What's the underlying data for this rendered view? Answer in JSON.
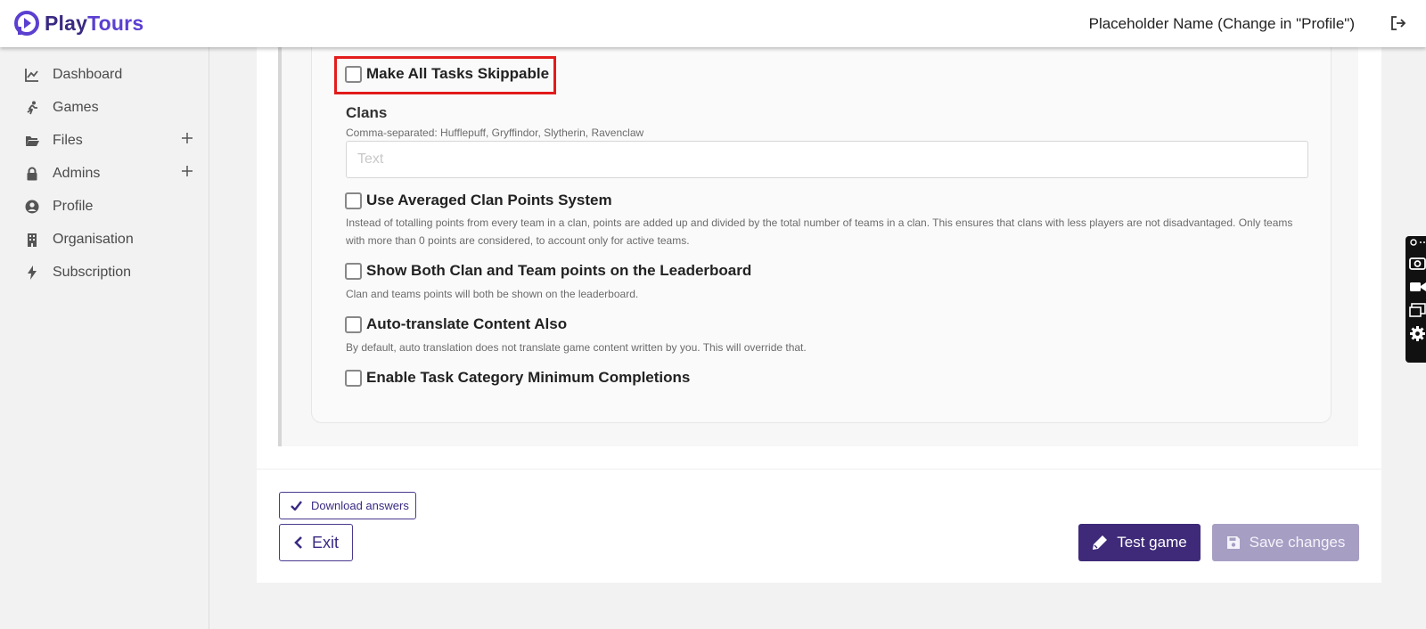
{
  "header": {
    "brand_play": "Play",
    "brand_tours": "Tours",
    "user_name": "Placeholder Name (Change in \"Profile\")"
  },
  "sidebar": {
    "items": [
      {
        "label": "Dashboard",
        "icon": "chart-line-icon"
      },
      {
        "label": "Games",
        "icon": "running-icon"
      },
      {
        "label": "Files",
        "icon": "folder-open-icon",
        "expandable": true
      },
      {
        "label": "Admins",
        "icon": "lock-icon",
        "expandable": true
      },
      {
        "label": "Profile",
        "icon": "user-circle-icon"
      },
      {
        "label": "Organisation",
        "icon": "building-icon"
      },
      {
        "label": "Subscription",
        "icon": "bolt-icon"
      }
    ]
  },
  "settings": {
    "skippable_label": "Make All Tasks Skippable",
    "clans_title": "Clans",
    "clans_helper": "Comma-separated: Hufflepuff, Gryffindor, Slytherin, Ravenclaw",
    "clans_placeholder": "Text",
    "clans_value": "",
    "averaged_label": "Use Averaged Clan Points System",
    "averaged_helper": "Instead of totalling points from every team in a clan, points are added up and divided by the total number of teams in a clan. This ensures that clans with less players are not disadvantaged. Only teams with more than 0 points are considered, to account only for active teams.",
    "both_points_label": "Show Both Clan and Team points on the Leaderboard",
    "both_points_helper": "Clan and teams points will both be shown on the leaderboard.",
    "autotranslate_label": "Auto-translate Content Also",
    "autotranslate_helper": "By default, auto translation does not translate game content written by you. This will override that.",
    "min_completions_label": "Enable Task Category Minimum Completions"
  },
  "footer": {
    "download_label": "Download answers",
    "exit_label": "Exit",
    "test_label": "Test game",
    "save_label": "Save changes"
  },
  "colors": {
    "brand": "#3a2a82",
    "test_button": "#3e2a78",
    "save_button_disabled": "#a79ec3",
    "highlight": "#e31b1b"
  }
}
